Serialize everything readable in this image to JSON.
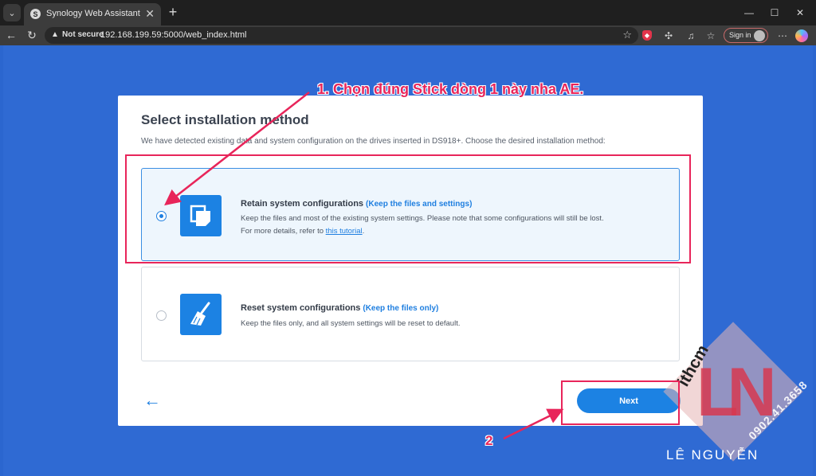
{
  "browser": {
    "tab_title": "Synology Web Assistant",
    "tab_close": "✕",
    "new_tab": "+",
    "security_label": "Not secure",
    "url": "192.168.199.59:5000/web_index.html",
    "signin_label": "Sign in"
  },
  "dialog": {
    "title": "Select installation method",
    "subtitle": "We have detected existing data and system configuration on the drives inserted in DS918+. Choose the desired installation method:",
    "options": [
      {
        "heading": "Retain system configurations",
        "hint": "(Keep the files and settings)",
        "desc_line1": "Keep the files and most of the existing system settings. Please note that some configurations will still be lost.",
        "desc_line2_prefix": "For more details, refer to ",
        "link": "this tutorial",
        "desc_line2_suffix": ".",
        "selected": true
      },
      {
        "heading": "Reset system configurations",
        "hint": "(Keep the files only)",
        "desc_line1": "Keep the files only, and all system settings will be reset to default.",
        "selected": false
      }
    ],
    "back_label": "←",
    "next_label": "Next"
  },
  "annotations": {
    "note1": "1. Chọn đúng Stick dòng 1 này nha AE.",
    "note2": "2",
    "color": "#e8255a"
  },
  "watermark": {
    "letters": "LN",
    "brand": "ithcm",
    "phone": "0902.41.3658",
    "name": "LÊ NGUYỄN"
  },
  "colors": {
    "page_background": "#2f6ad3",
    "primary": "#1c82e3",
    "selected_bg": "#eef6fd"
  }
}
